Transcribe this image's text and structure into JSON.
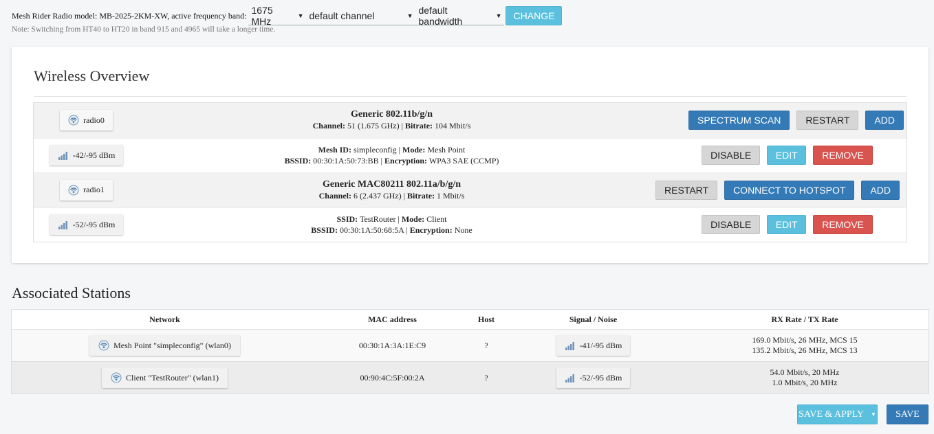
{
  "header": {
    "model_text": "Mesh Rider Radio model: MB-2025-2KM-XW, active frequency band:",
    "frequency_band": "1675 MHz",
    "channel": "default channel",
    "bandwidth": "default bandwidth",
    "change_label": "CHANGE",
    "note": "Note: Switching from HT40 to HT20 in band 915 and 4965 will take a longer time."
  },
  "overview": {
    "title": "Wireless Overview",
    "radios": [
      {
        "name": "radio0",
        "title": "Generic 802.11b/g/n",
        "channel_label": "Channel:",
        "channel_value": "51 (1.675 GHz)",
        "bitrate_label": "Bitrate:",
        "bitrate_value": "104 Mbit/s",
        "spectrum_label": "SPECTRUM SCAN",
        "restart_label": "RESTART",
        "add_label": "ADD",
        "network": {
          "signal": "-42/-95 dBm",
          "id_label": "Mesh ID:",
          "id_value": "simpleconfig",
          "mode_label": "Mode:",
          "mode_value": "Mesh Point",
          "bssid_label": "BSSID:",
          "bssid_value": "00:30:1A:50:73:BB",
          "enc_label": "Encryption:",
          "enc_value": "WPA3 SAE (CCMP)",
          "disable_label": "DISABLE",
          "edit_label": "EDIT",
          "remove_label": "REMOVE"
        }
      },
      {
        "name": "radio1",
        "title": "Generic MAC80211 802.11a/b/g/n",
        "channel_label": "Channel:",
        "channel_value": "6 (2.437 GHz)",
        "bitrate_label": "Bitrate:",
        "bitrate_value": "1 Mbit/s",
        "restart_label": "RESTART",
        "connect_label": "CONNECT TO HOTSPOT",
        "add_label": "ADD",
        "network": {
          "signal": "-52/-95 dBm",
          "id_label": "SSID:",
          "id_value": "TestRouter",
          "mode_label": "Mode:",
          "mode_value": "Client",
          "bssid_label": "BSSID:",
          "bssid_value": "00:30:1A:50:68:5A",
          "enc_label": "Encryption:",
          "enc_value": "None",
          "disable_label": "DISABLE",
          "edit_label": "EDIT",
          "remove_label": "REMOVE"
        }
      }
    ]
  },
  "stations": {
    "title": "Associated Stations",
    "columns": [
      "Network",
      "MAC address",
      "Host",
      "Signal / Noise",
      "RX Rate / TX Rate"
    ],
    "rows": [
      {
        "network": "Mesh Point \"simpleconfig\" (wlan0)",
        "mac": "00:30:1A:3A:1E:C9",
        "host": "?",
        "signal": "-41/-95 dBm",
        "rx": "169.0 Mbit/s, 26 MHz, MCS 15",
        "tx": "135.2 Mbit/s, 26 MHz, MCS 13"
      },
      {
        "network": "Client \"TestRouter\" (wlan1)",
        "mac": "00:90:4C:5F:00:2A",
        "host": "?",
        "signal": "-52/-95 dBm",
        "rx": "54.0 Mbit/s, 20 MHz",
        "tx": "1.0 Mbit/s, 20 MHz"
      }
    ]
  },
  "footer": {
    "save_apply_label": "SAVE & APPLY",
    "save_label": "SAVE"
  },
  "colors": {
    "primary": "#337ab7",
    "info": "#5bc0de",
    "danger": "#d9534f",
    "default": "#d6d6d6"
  },
  "icons": [
    "wifi-radio-icon",
    "signal-bars-icon",
    "chevron-down-icon",
    "caret-down-icon"
  ]
}
